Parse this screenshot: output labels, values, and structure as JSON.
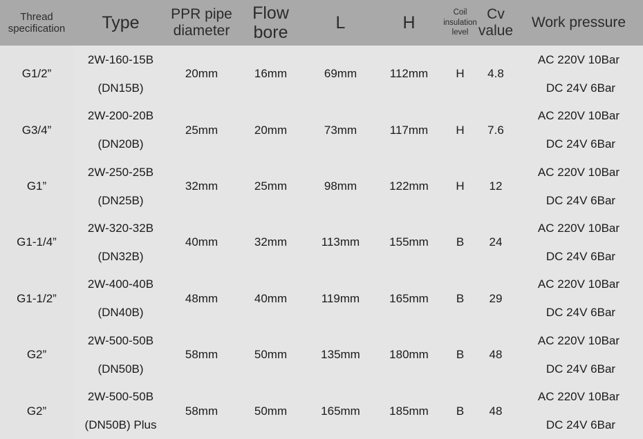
{
  "table": {
    "headers": [
      {
        "id": "thread-specification",
        "label": "Thread specification",
        "style": "small"
      },
      {
        "id": "type",
        "label": "Type",
        "style": "big"
      },
      {
        "id": "ppr-pipe-diameter",
        "label": "PPR pipe diameter",
        "style": "normal"
      },
      {
        "id": "flow-bore",
        "label": "Flow bore",
        "style": "big"
      },
      {
        "id": "l",
        "label": "L",
        "style": "big"
      },
      {
        "id": "h",
        "label": "H",
        "style": "big"
      },
      {
        "id": "coil-insulation-level",
        "label": "Coil insulation level",
        "style": "tiny"
      },
      {
        "id": "cv-value",
        "label": "Cv value",
        "style": "normal"
      },
      {
        "id": "work-pressure",
        "label": "Work pressure",
        "style": "normal"
      }
    ],
    "rows": [
      {
        "thread": "G1/2”",
        "type_line1": "2W-160-15B",
        "type_line2": "(DN15B)",
        "ppr": "20mm",
        "bore": "16mm",
        "l": "69mm",
        "h": "112mm",
        "coil": "H",
        "cv": "4.8",
        "press_line1": "AC 220V  10Bar",
        "press_line2": "DC 24V   6Bar"
      },
      {
        "thread": "G3/4”",
        "type_line1": "2W-200-20B",
        "type_line2": "(DN20B)",
        "ppr": "25mm",
        "bore": "20mm",
        "l": "73mm",
        "h": "117mm",
        "coil": "H",
        "cv": "7.6",
        "press_line1": "AC 220V  10Bar",
        "press_line2": "DC 24V   6Bar"
      },
      {
        "thread": "G1”",
        "type_line1": "2W-250-25B",
        "type_line2": "(DN25B)",
        "ppr": "32mm",
        "bore": "25mm",
        "l": "98mm",
        "h": "122mm",
        "coil": "H",
        "cv": "12",
        "press_line1": "AC 220V  10Bar",
        "press_line2": "DC 24V   6Bar"
      },
      {
        "thread": "G1-1/4”",
        "type_line1": "2W-320-32B",
        "type_line2": "(DN32B)",
        "ppr": "40mm",
        "bore": "32mm",
        "l": "113mm",
        "h": "155mm",
        "coil": "B",
        "cv": "24",
        "press_line1": "AC 220V  10Bar",
        "press_line2": "DC 24V   6Bar"
      },
      {
        "thread": "G1-1/2”",
        "type_line1": "2W-400-40B",
        "type_line2": "(DN40B)",
        "ppr": "48mm",
        "bore": "40mm",
        "l": "119mm",
        "h": "165mm",
        "coil": "B",
        "cv": "29",
        "press_line1": "AC 220V  10Bar",
        "press_line2": "DC 24V   6Bar"
      },
      {
        "thread": "G2”",
        "type_line1": "2W-500-50B",
        "type_line2": "(DN50B)",
        "ppr": "58mm",
        "bore": "50mm",
        "l": "135mm",
        "h": "180mm",
        "coil": "B",
        "cv": "48",
        "press_line1": "AC 220V  10Bar",
        "press_line2": "DC 24V   6Bar"
      },
      {
        "thread": "G2”",
        "type_line1": "2W-500-50B",
        "type_line2": "(DN50B) Plus",
        "ppr": "58mm",
        "bore": "50mm",
        "l": "165mm",
        "h": "185mm",
        "coil": "B",
        "cv": "48",
        "press_line1": "AC 220V  10Bar",
        "press_line2": "DC 24V   6Bar"
      }
    ]
  },
  "colors": {
    "header_background": "#a9a9a9",
    "cell_background": "#e5e5e5",
    "thread_column_background": "#e3e3e3",
    "grid_line": "#fafafa",
    "text": "#1a1a1a"
  }
}
